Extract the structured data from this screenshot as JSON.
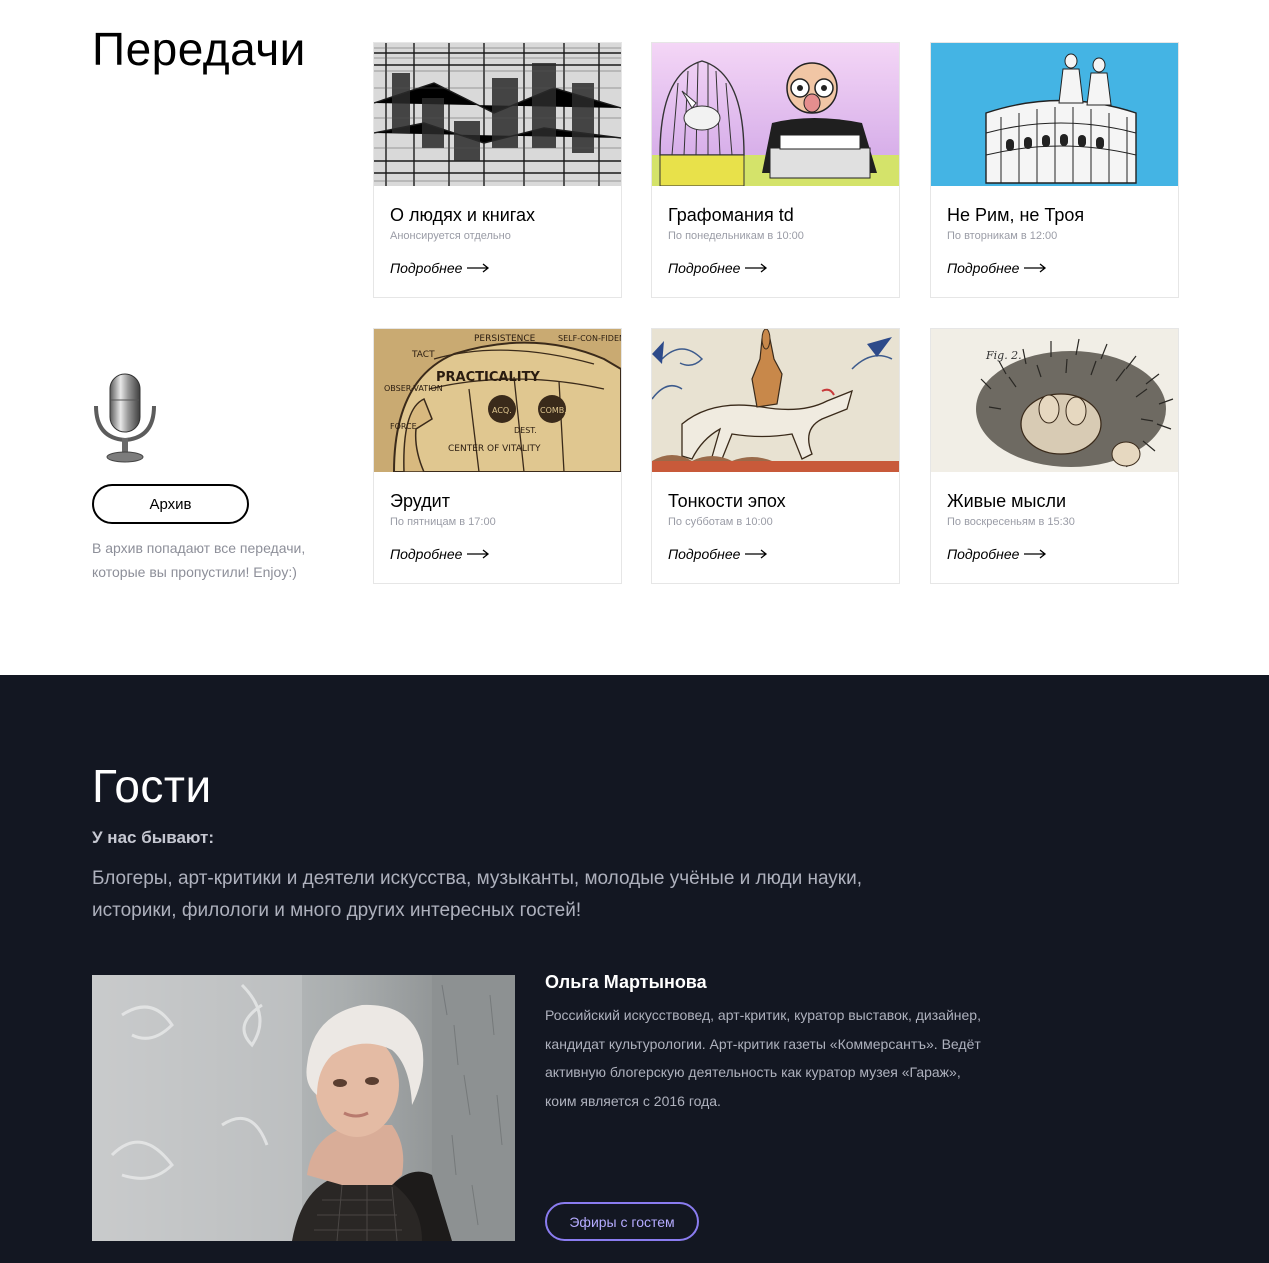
{
  "programs": {
    "title": "Передачи",
    "archive": {
      "button_label": "Архив",
      "note": "В архив попадают все передачи, которые вы пропустили! Enjoy:)"
    },
    "more_label": "Подробнее",
    "cards": [
      {
        "title": "О людях и книгах",
        "schedule": "Анонсируется отдельно"
      },
      {
        "title": "Графомания td",
        "schedule": "По понедельникам в 10:00"
      },
      {
        "title": "Не Рим, не Троя",
        "schedule": "По вторникам в 12:00"
      },
      {
        "title": "Эрудит",
        "schedule": "По пятницам в 17:00"
      },
      {
        "title": "Тонкости эпох",
        "schedule": "По субботам в 10:00"
      },
      {
        "title": "Живые мысли",
        "schedule": "По воскресеньям в 15:30"
      }
    ],
    "phrenology_labels": [
      "PERSISTENCE",
      "SELF-CON-FIDENCE",
      "TACT",
      "PRACTICALITY",
      "OBSER-VATION",
      "ACQ.",
      "COMB.",
      "DEST.",
      "FORCE",
      "CENTER OF VITALITY"
    ],
    "hedgehog_label": "Fig. 2."
  },
  "guests": {
    "title": "Гости",
    "subtitle": "У нас бывают:",
    "description": "Блогеры, арт-критики и деятели искусства, музыканты, молодые учёные и люди науки, историки, филологи и много других интересных гостей!",
    "featured": {
      "name": "Ольга Мартынова",
      "bio": "Российский искусствовед, арт-критик, куратор выставок, дизайнер, кандидат культурологии. Арт-критик газеты «Коммерсантъ». Ведёт активную блогерскую деятельность как куратор музея «Гараж», коим является с 2016 года.",
      "button_label": "Эфиры с гостем"
    }
  },
  "colors": {
    "dark_bg": "#131722",
    "accent_purple": "#8a7cf0",
    "muted_text": "#8d8f99"
  }
}
